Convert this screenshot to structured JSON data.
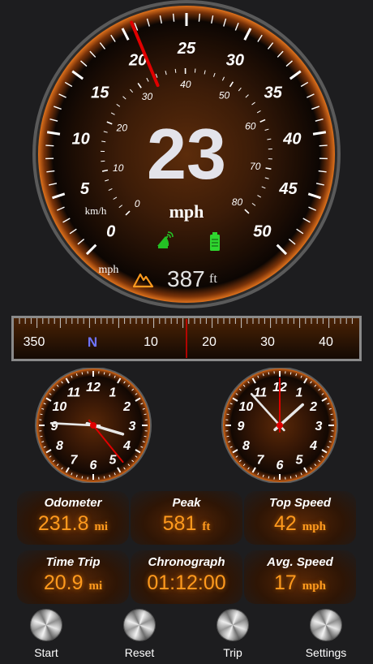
{
  "speedometer": {
    "speed": "23",
    "unit": "mph",
    "needle_mph": 20.8,
    "outer_labels": [
      "0",
      "5",
      "10",
      "15",
      "20",
      "25",
      "30",
      "35",
      "40",
      "45",
      "50"
    ],
    "inner_labels": [
      "0",
      "10",
      "20",
      "30",
      "40",
      "50",
      "60",
      "70",
      "80"
    ],
    "inner_unit": "km/h",
    "outer_unit": "mph",
    "altitude": "387",
    "altitude_unit": "ft",
    "gps_icon": "satellite-dish-icon",
    "battery_icon": "battery-icon",
    "altitude_icon": "mountain-icon"
  },
  "compass": {
    "labels": [
      "350",
      "N",
      "10",
      "20",
      "30",
      "40"
    ],
    "heading_deg": 15
  },
  "clocks": {
    "numbers": [
      "12",
      "1",
      "2",
      "3",
      "4",
      "5",
      "6",
      "7",
      "8",
      "9",
      "10",
      "11"
    ],
    "left": {
      "hour": 3.55,
      "minute": 9.1,
      "second": 4.7
    },
    "right": {
      "hour": 1.6,
      "minute": 10.6,
      "second": 0
    }
  },
  "stats": {
    "odometer": {
      "label": "Odometer",
      "value": "231.8",
      "unit": "mi"
    },
    "peak": {
      "label": "Peak",
      "value": "581",
      "unit": "ft"
    },
    "top_speed": {
      "label": "Top Speed",
      "value": "42",
      "unit": "mph"
    },
    "time_trip": {
      "label": "Time Trip",
      "value": "20.9",
      "unit": "mi"
    },
    "chronograph": {
      "label": "Chronograph",
      "value": "01:12:00"
    },
    "avg_speed": {
      "label": "Avg. Speed",
      "value": "17",
      "unit": "mph"
    }
  },
  "buttons": {
    "start": "Start",
    "reset": "Reset",
    "trip": "Trip",
    "settings": "Settings"
  },
  "colors": {
    "accent": "#ff9a1e",
    "needle": "#e00000",
    "gps": "#24c024",
    "battery": "#2fd62f"
  }
}
